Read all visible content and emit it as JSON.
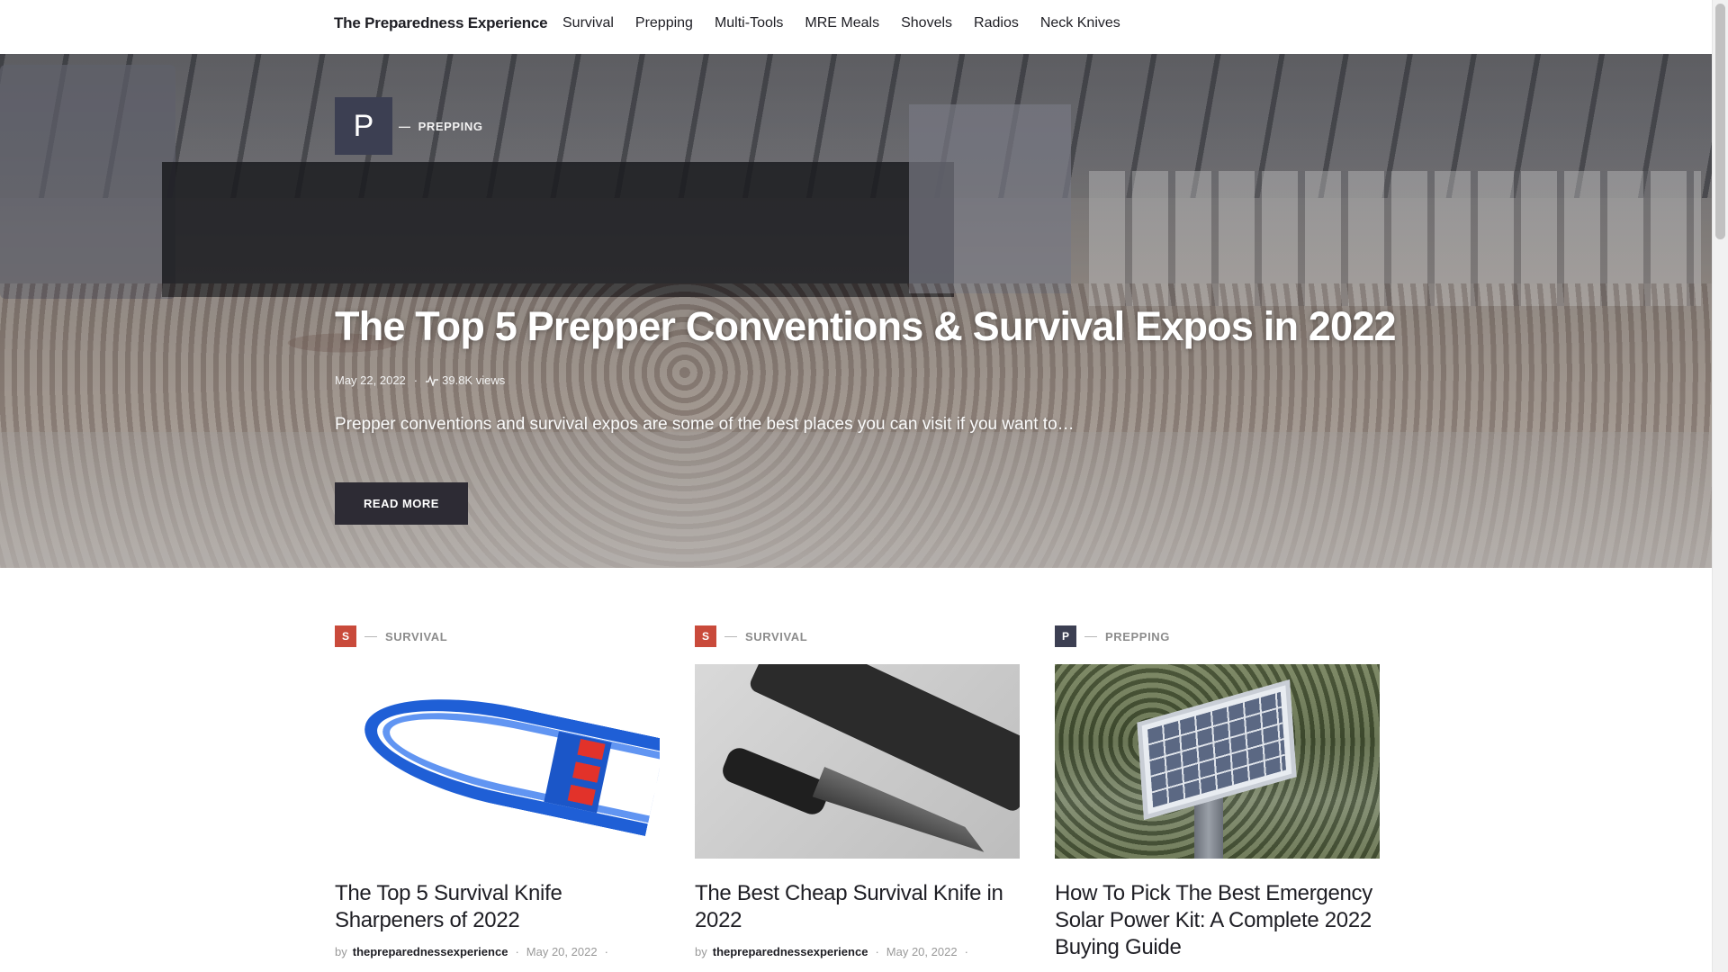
{
  "site": {
    "brand": "The Preparedness Experience"
  },
  "nav": {
    "items": [
      "Survival",
      "Prepping",
      "Multi-Tools",
      "MRE Meals",
      "Shovels",
      "Radios",
      "Neck Knives"
    ]
  },
  "colors": {
    "survival": "#c94a3b",
    "prepping": "#3c3f52",
    "button": "#2d2b34"
  },
  "hero": {
    "category_letter": "P",
    "category_dash": "—",
    "category": "PREPPING",
    "title": "The Top 5 Prepper Conventions & Survival Expos in 2022",
    "date": "May 22, 2022",
    "separator": "·",
    "views": "39.8K views",
    "views_icon": "activity-icon",
    "excerpt": "Prepper conventions and survival expos are some of the best places you can visit if you want to…",
    "button": "READ MORE"
  },
  "cards": [
    {
      "category_letter": "S",
      "category": "SURVIVAL",
      "image": "survival-knife-sharpener-image",
      "title": "The Top 5 Survival Knife Sharpeners of 2022",
      "by": "by",
      "author": "thepreparednessexperience",
      "date": "May 20, 2022",
      "trail": "·"
    },
    {
      "category_letter": "S",
      "category": "SURVIVAL",
      "image": "survival-knife-image",
      "title": "The Best Cheap Survival Knife in 2022",
      "by": "by",
      "author": "thepreparednessexperience",
      "date": "May 20, 2022",
      "trail": "·"
    },
    {
      "category_letter": "P",
      "category": "PREPPING",
      "image": "solar-panel-image",
      "title": "How To Pick The Best Emergency Solar Power Kit: A Complete 2022 Buying Guide"
    }
  ]
}
